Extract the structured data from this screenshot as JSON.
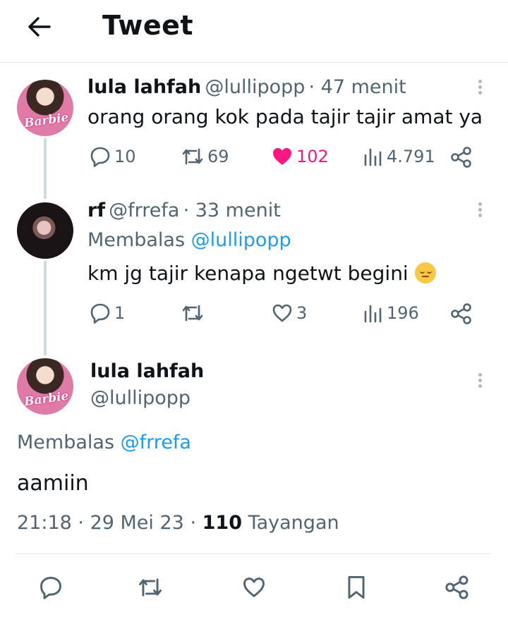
{
  "header": {
    "title": "Tweet"
  },
  "tweet1": {
    "name": "lula lahfah",
    "handle": "@lullipopp",
    "time": "· 47 menit",
    "avatar_text": "Barbie",
    "text": "orang orang kok pada tajir tajir amat ya",
    "replies": "10",
    "retweets": "69",
    "likes": "102",
    "views": "4.791"
  },
  "tweet2": {
    "name": "rf",
    "handle": "@frrefa",
    "time": "· 33 menit",
    "reply_prefix": "Membalas",
    "reply_to": "@lullipopp",
    "text": "km jg tajir kenapa ngetwt begini",
    "emoji_icon": "pensive-face-icon",
    "replies": "1",
    "likes": "3",
    "views": "196"
  },
  "tweet3": {
    "name": "lula lahfah",
    "handle": "@lullipopp",
    "avatar_text": "Barbie",
    "reply_prefix": "Membalas",
    "reply_to": "@frrefa",
    "text": "aamiin",
    "time": "21:18",
    "date": "· 29 Mei 23 ·",
    "views_count": "110",
    "views_label": "Tayangan"
  },
  "colors": {
    "like_active": "#f91880",
    "link": "#1d9bf0",
    "muted": "#536471"
  }
}
